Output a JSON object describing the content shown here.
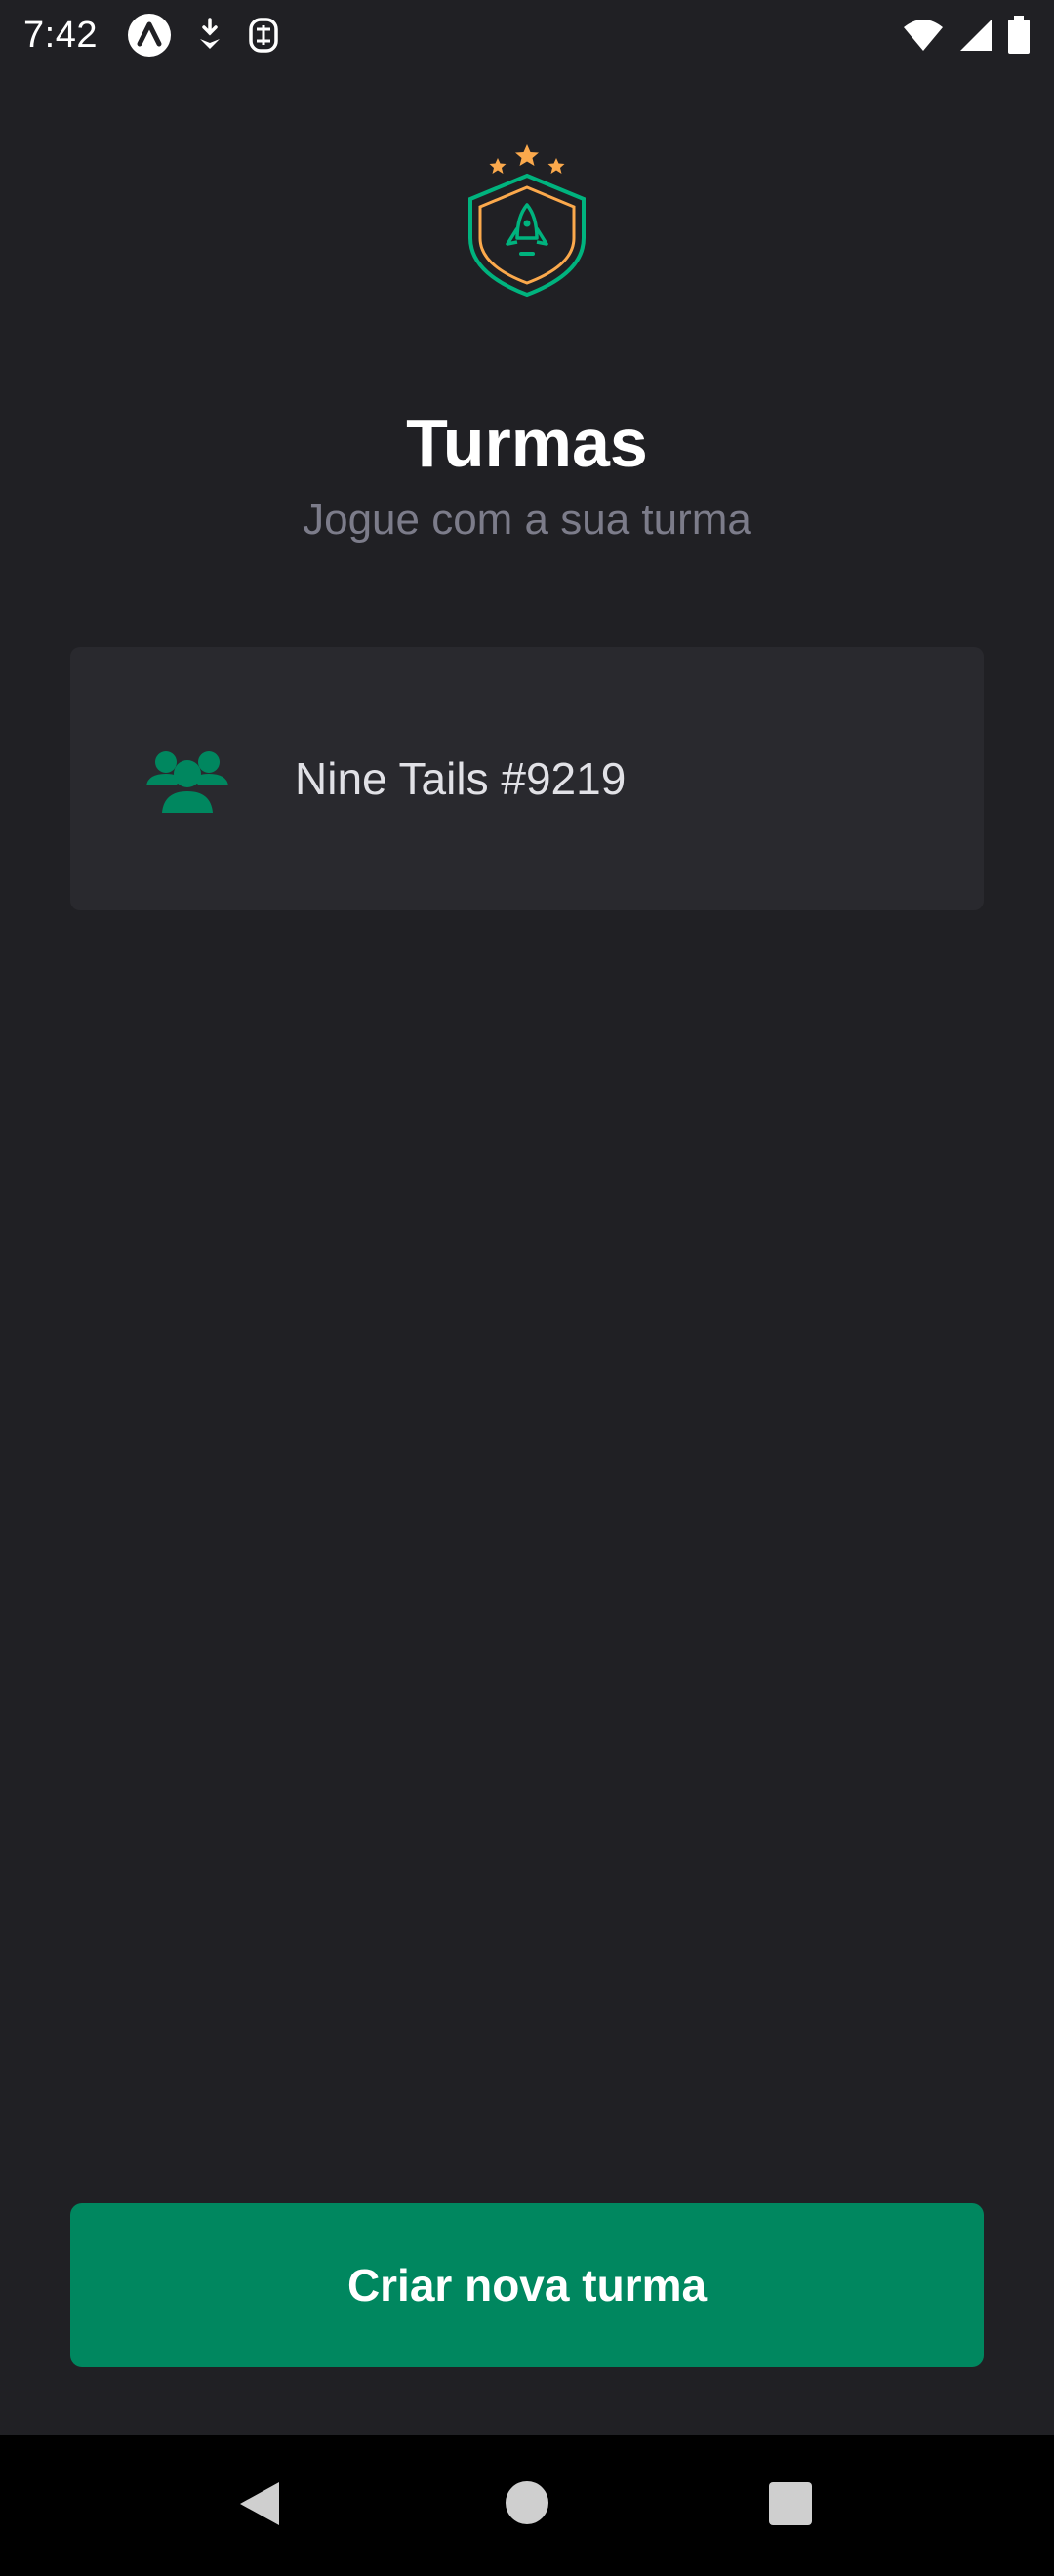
{
  "status_bar": {
    "time": "7:42",
    "left_icons": [
      "expo-icon",
      "download-icon",
      "shield-icon"
    ],
    "right_icons": [
      "wifi-icon",
      "signal-icon",
      "battery-icon"
    ]
  },
  "header": {
    "title": "Turmas",
    "subtitle": "Jogue com a sua turma"
  },
  "groups": [
    {
      "name": "Nine Tails #9219",
      "icon": "users-icon"
    }
  ],
  "actions": {
    "create_label": "Criar nova turma"
  },
  "colors": {
    "background": "#202024",
    "card": "#29292e",
    "accent_green": "#00875f",
    "star_orange": "#fba94c",
    "subtitle_gray": "#7c7c8a"
  },
  "nav": {
    "icons": [
      "back-icon",
      "home-icon",
      "recents-icon"
    ]
  }
}
